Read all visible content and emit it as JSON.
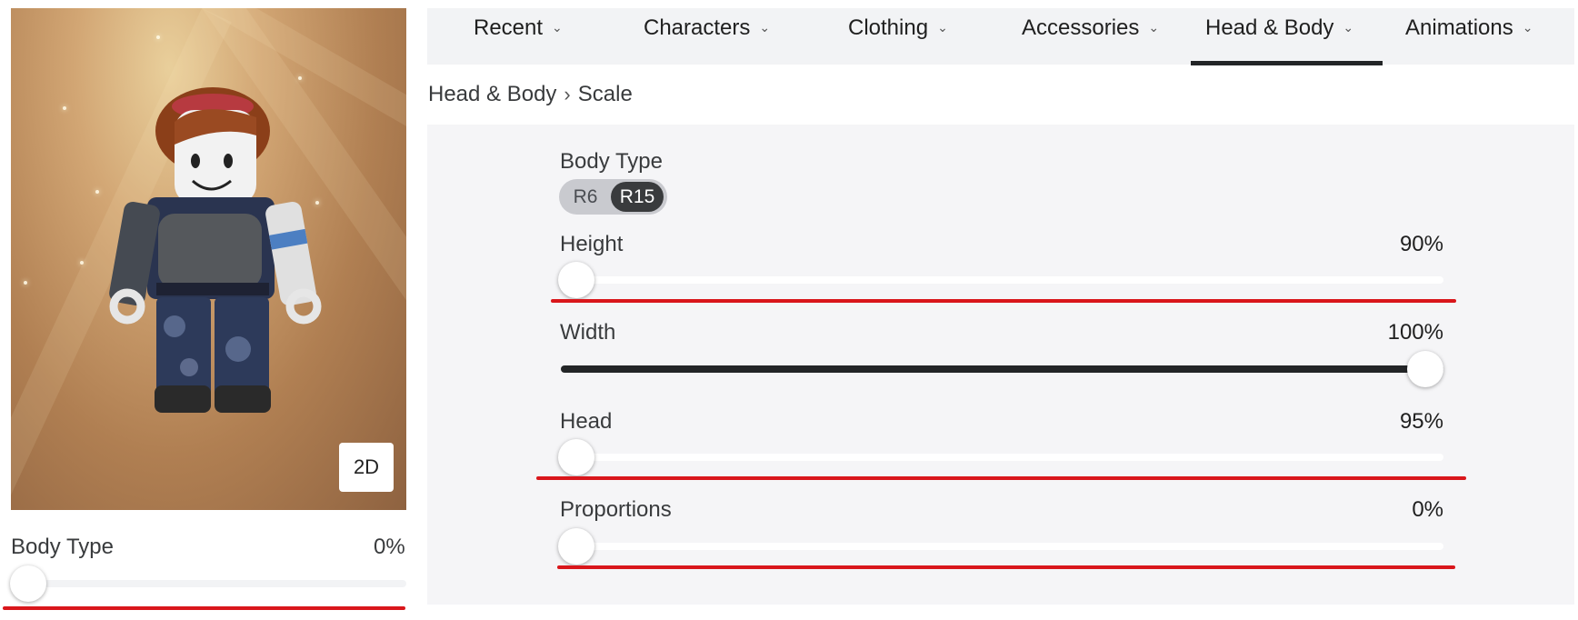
{
  "tabs": [
    {
      "label": "Recent"
    },
    {
      "label": "Characters"
    },
    {
      "label": "Clothing"
    },
    {
      "label": "Accessories"
    },
    {
      "label": "Head & Body",
      "active": true
    },
    {
      "label": "Animations"
    }
  ],
  "breadcrumb": {
    "parent": "Head & Body",
    "current": "Scale"
  },
  "avatar_preview": {
    "view_toggle_label": "2D"
  },
  "left_slider": {
    "label": "Body Type",
    "value": "0%",
    "fraction": 0
  },
  "scale": {
    "body_type": {
      "label": "Body Type",
      "options": [
        "R6",
        "R15"
      ],
      "selected": "R15"
    },
    "height": {
      "label": "Height",
      "value": "90%",
      "fraction": 0
    },
    "width": {
      "label": "Width",
      "value": "100%",
      "fraction": 1
    },
    "head": {
      "label": "Head",
      "value": "95%",
      "fraction": 0
    },
    "proportions": {
      "label": "Proportions",
      "value": "0%",
      "fraction": 0
    }
  },
  "icons": {
    "tab_chevron": "chevron-down-icon",
    "breadcrumb_separator": "chevron-right-icon"
  },
  "colors": {
    "active_tab": "#232527",
    "annotation": "#d9161b",
    "toggle_selected": "#393b3d"
  }
}
